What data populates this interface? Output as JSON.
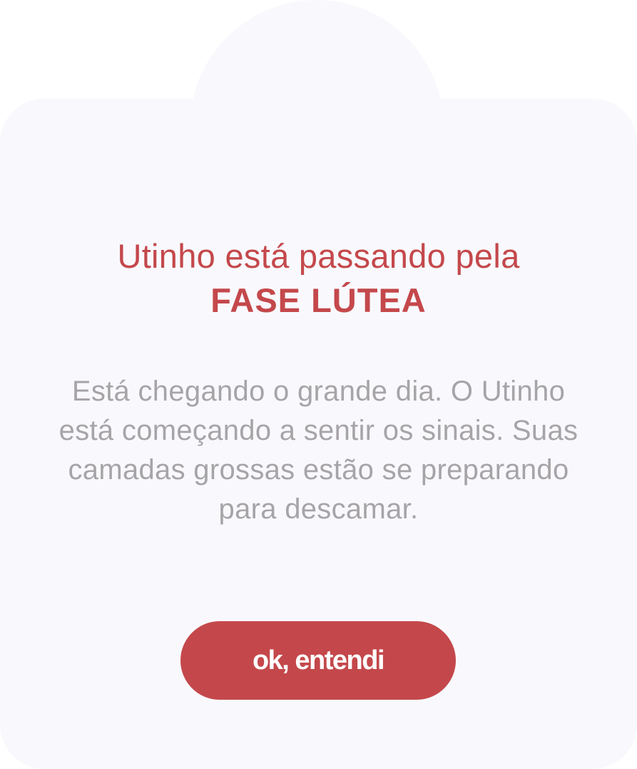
{
  "modal": {
    "title_line1": "Utinho está passando pela",
    "title_line2": "FASE LÚTEA",
    "description": "Está chegando o grande dia. O Utinho está começando a sentir os sinais. Suas camadas grossas estão se preparando para descamar.",
    "button_label": "ok, entendi"
  },
  "colors": {
    "accent": "#c4484b",
    "card_background": "#f9f9fd",
    "body_text": "#a7a4a7",
    "button_text": "#ffffff"
  }
}
